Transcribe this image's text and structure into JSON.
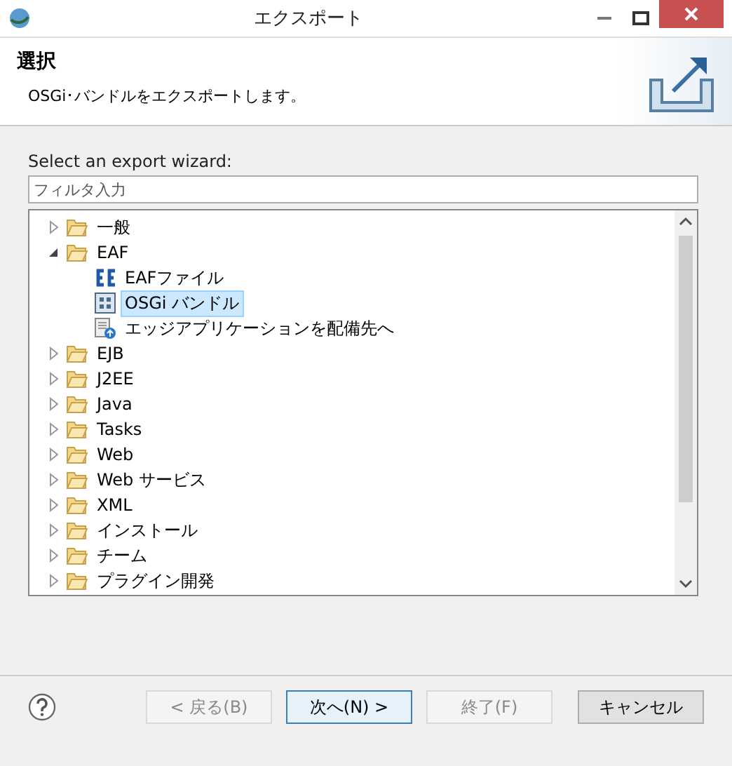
{
  "window": {
    "title": "エクスポート"
  },
  "header": {
    "title": "選択",
    "description": "OSGi･バンドルをエクスポートします。"
  },
  "wizard_label": "Select an export wizard:",
  "filter": {
    "placeholder": "フィルタ入力"
  },
  "tree": [
    {
      "label": "一般",
      "kind": "folder",
      "expanded": false,
      "selected": false
    },
    {
      "label": "EAF",
      "kind": "folder",
      "expanded": true,
      "selected": false,
      "children": [
        {
          "label": "EAFファイル",
          "kind": "eaf-file",
          "selected": false
        },
        {
          "label": "OSGi バンドル",
          "kind": "bundle",
          "selected": true
        },
        {
          "label": "エッジアプリケーションを配備先へ",
          "kind": "deploy",
          "selected": false
        }
      ]
    },
    {
      "label": "EJB",
      "kind": "folder",
      "expanded": false,
      "selected": false
    },
    {
      "label": "J2EE",
      "kind": "folder",
      "expanded": false,
      "selected": false
    },
    {
      "label": "Java",
      "kind": "folder",
      "expanded": false,
      "selected": false
    },
    {
      "label": "Tasks",
      "kind": "folder",
      "expanded": false,
      "selected": false
    },
    {
      "label": "Web",
      "kind": "folder",
      "expanded": false,
      "selected": false
    },
    {
      "label": "Web サービス",
      "kind": "folder",
      "expanded": false,
      "selected": false
    },
    {
      "label": "XML",
      "kind": "folder",
      "expanded": false,
      "selected": false
    },
    {
      "label": "インストール",
      "kind": "folder",
      "expanded": false,
      "selected": false
    },
    {
      "label": "チーム",
      "kind": "folder",
      "expanded": false,
      "selected": false
    },
    {
      "label": "プラグイン開発",
      "kind": "folder",
      "expanded": false,
      "selected": false
    }
  ],
  "buttons": [
    {
      "label": "< 戻る(B)",
      "disabled": true,
      "default": false
    },
    {
      "label": "次へ(N) >",
      "disabled": false,
      "default": true
    },
    {
      "label": "終了(F)",
      "disabled": true,
      "default": false
    },
    {
      "label": "キャンセル",
      "disabled": false,
      "default": false
    }
  ]
}
